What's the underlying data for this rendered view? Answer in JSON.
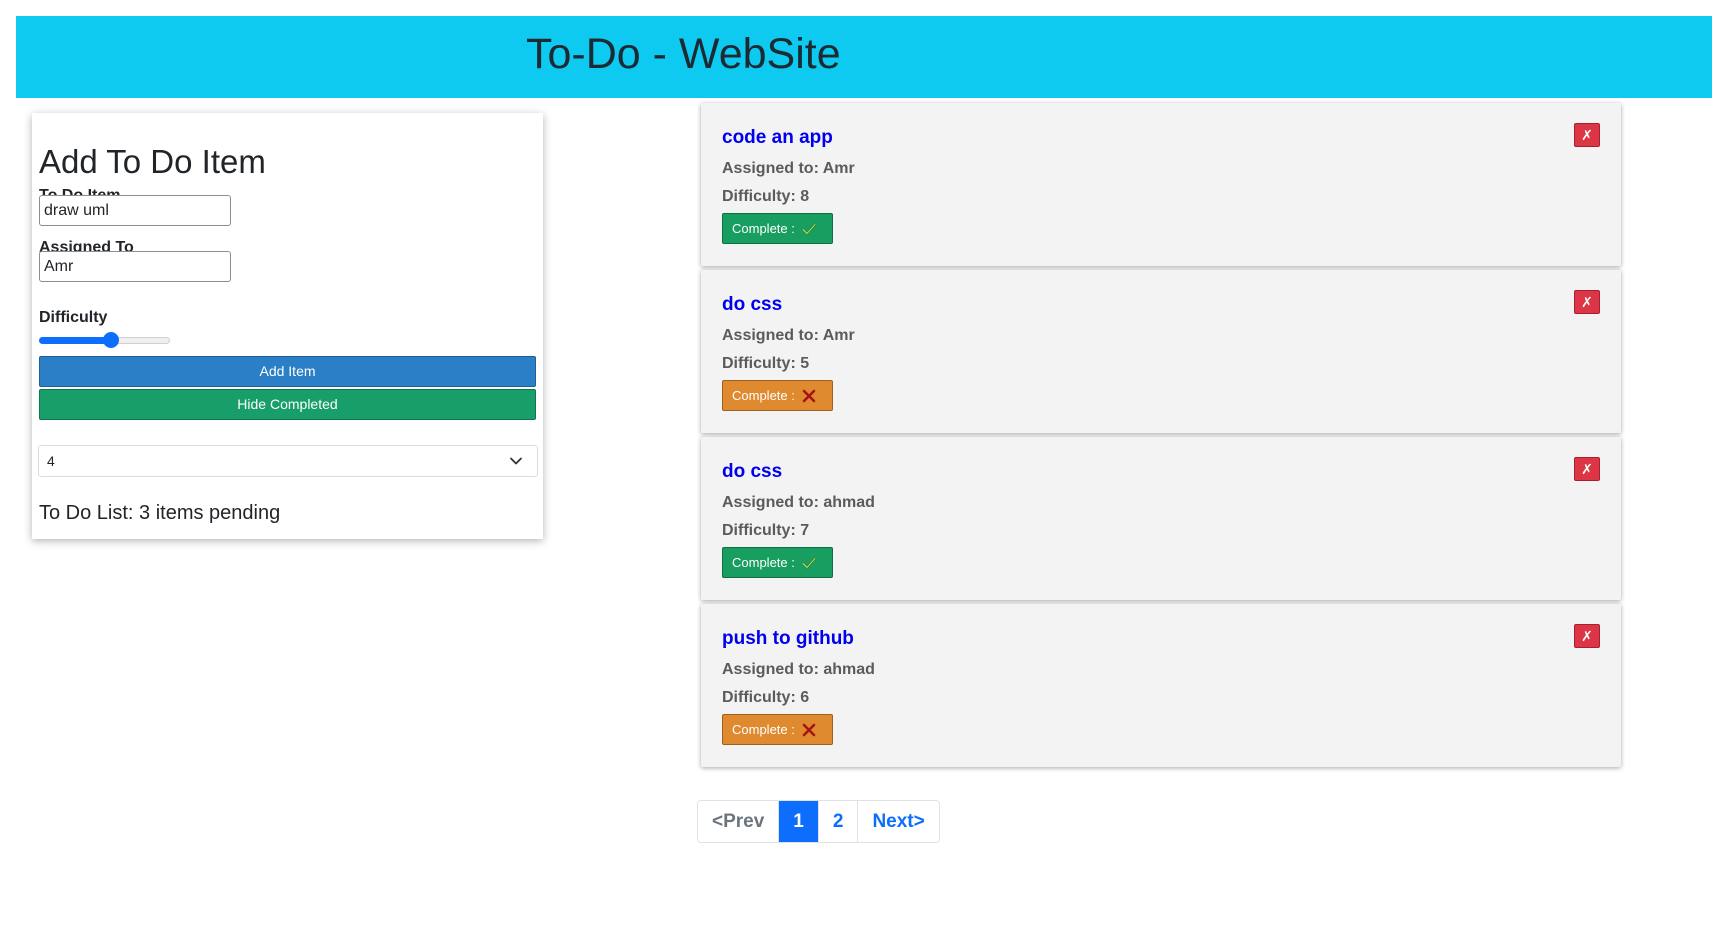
{
  "header": {
    "title": "To-Do - WebSite"
  },
  "form": {
    "heading": "Add To Do Item",
    "item_label": "To Do Item",
    "item_value": "draw uml",
    "assigned_label": "Assigned To",
    "assigned_value": "Amr",
    "difficulty_label": "Difficulty",
    "difficulty_fraction": 0.55,
    "add_button": "Add Item",
    "hide_button": "Hide Completed",
    "per_page_value": "4",
    "pending_text": "To Do List: 3 items pending"
  },
  "items": [
    {
      "title": "code an app",
      "assigned": "Assigned to: Amr",
      "difficulty": "Difficulty: 8",
      "complete_label": "Complete :",
      "status": "done",
      "delete_label": "✗"
    },
    {
      "title": "do css",
      "assigned": "Assigned to: Amr",
      "difficulty": "Difficulty: 5",
      "complete_label": "Complete :",
      "status": "notdone",
      "delete_label": "✗"
    },
    {
      "title": "do css",
      "assigned": "Assigned to: ahmad",
      "difficulty": "Difficulty: 7",
      "complete_label": "Complete :",
      "status": "done",
      "delete_label": "✗"
    },
    {
      "title": "push to github",
      "assigned": "Assigned to: ahmad",
      "difficulty": "Difficulty: 6",
      "complete_label": "Complete :",
      "status": "notdone",
      "delete_label": "✗"
    }
  ],
  "pagination": {
    "prev": "<Prev",
    "pages": [
      "1",
      "2"
    ],
    "active": "1",
    "next": "Next>"
  },
  "icons": {
    "done": "check-icon",
    "notdone": "cross-icon",
    "delete": "delete-x-icon"
  },
  "colors": {
    "header_bg": "#0ecaf0",
    "add_button": "#2a7fc7",
    "hide_button": "#179e69",
    "complete_done": "#179e60",
    "complete_pending": "#e08a2f",
    "delete_button": "#dc3545",
    "link": "#0000ee",
    "pager_active": "#0d6efd"
  }
}
